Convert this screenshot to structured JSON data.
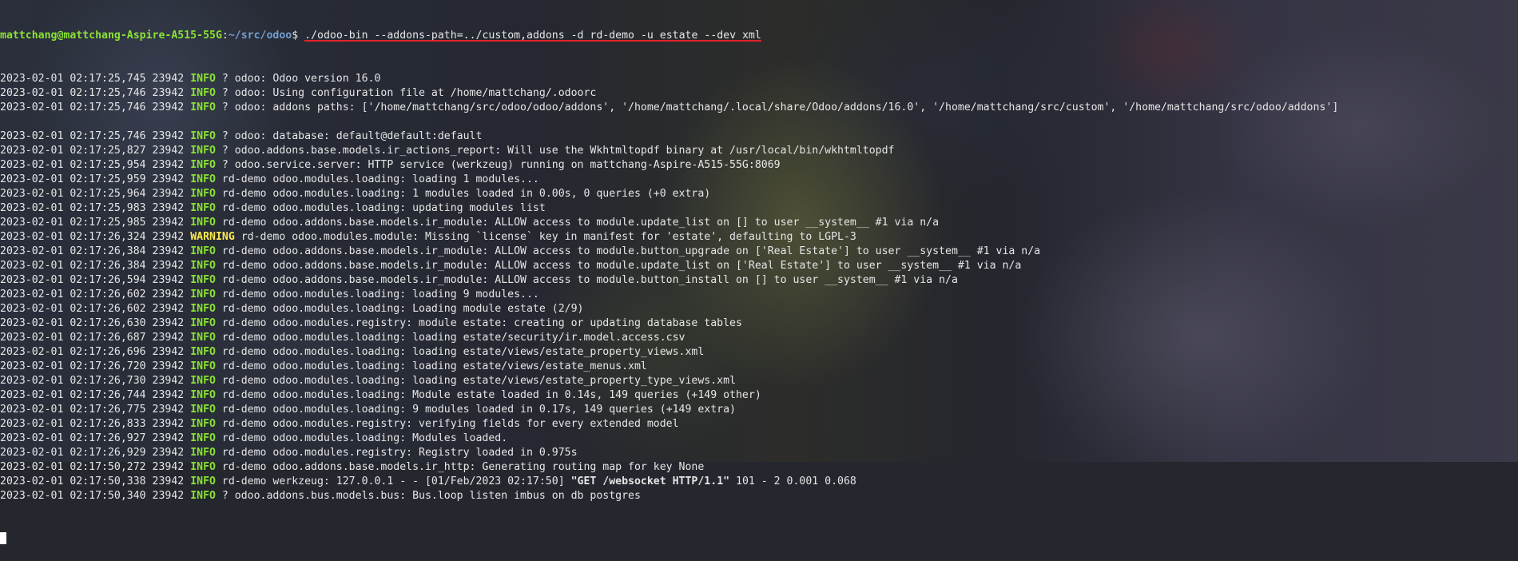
{
  "prompt": {
    "user_host": "mattchang@mattchang-Aspire-A515-55G",
    "separator": ":",
    "path": "~/src/odoo",
    "symbol": "$ ",
    "command": "./odoo-bin --addons-path=../custom,addons -d rd-demo -u estate --dev xml"
  },
  "log_lines": [
    {
      "ts": "2023-02-01 02:17:25,745 23942 ",
      "level": "INFO",
      "msg": " ? odoo: Odoo version 16.0"
    },
    {
      "ts": "2023-02-01 02:17:25,746 23942 ",
      "level": "INFO",
      "msg": " ? odoo: Using configuration file at /home/mattchang/.odoorc"
    },
    {
      "ts": "2023-02-01 02:17:25,746 23942 ",
      "level": "INFO",
      "msg": " ? odoo: addons paths: ['/home/mattchang/src/odoo/odoo/addons', '/home/mattchang/.local/share/Odoo/addons/16.0', '/home/mattchang/src/custom', '/home/mattchang/src/odoo/addons']"
    },
    {
      "ts": "",
      "level": "",
      "msg": ""
    },
    {
      "ts": "2023-02-01 02:17:25,746 23942 ",
      "level": "INFO",
      "msg": " ? odoo: database: default@default:default"
    },
    {
      "ts": "2023-02-01 02:17:25,827 23942 ",
      "level": "INFO",
      "msg": " ? odoo.addons.base.models.ir_actions_report: Will use the Wkhtmltopdf binary at /usr/local/bin/wkhtmltopdf"
    },
    {
      "ts": "2023-02-01 02:17:25,954 23942 ",
      "level": "INFO",
      "msg": " ? odoo.service.server: HTTP service (werkzeug) running on mattchang-Aspire-A515-55G:8069"
    },
    {
      "ts": "2023-02-01 02:17:25,959 23942 ",
      "level": "INFO",
      "msg": " rd-demo odoo.modules.loading: loading 1 modules..."
    },
    {
      "ts": "2023-02-01 02:17:25,964 23942 ",
      "level": "INFO",
      "msg": " rd-demo odoo.modules.loading: 1 modules loaded in 0.00s, 0 queries (+0 extra)"
    },
    {
      "ts": "2023-02-01 02:17:25,983 23942 ",
      "level": "INFO",
      "msg": " rd-demo odoo.modules.loading: updating modules list"
    },
    {
      "ts": "2023-02-01 02:17:25,985 23942 ",
      "level": "INFO",
      "msg": " rd-demo odoo.addons.base.models.ir_module: ALLOW access to module.update_list on [] to user __system__ #1 via n/a"
    },
    {
      "ts": "2023-02-01 02:17:26,324 23942 ",
      "level": "WARNING",
      "msg": " rd-demo odoo.modules.module: Missing `license` key in manifest for 'estate', defaulting to LGPL-3"
    },
    {
      "ts": "2023-02-01 02:17:26,384 23942 ",
      "level": "INFO",
      "msg": " rd-demo odoo.addons.base.models.ir_module: ALLOW access to module.button_upgrade on ['Real Estate'] to user __system__ #1 via n/a"
    },
    {
      "ts": "2023-02-01 02:17:26,384 23942 ",
      "level": "INFO",
      "msg": " rd-demo odoo.addons.base.models.ir_module: ALLOW access to module.update_list on ['Real Estate'] to user __system__ #1 via n/a"
    },
    {
      "ts": "2023-02-01 02:17:26,594 23942 ",
      "level": "INFO",
      "msg": " rd-demo odoo.addons.base.models.ir_module: ALLOW access to module.button_install on [] to user __system__ #1 via n/a"
    },
    {
      "ts": "2023-02-01 02:17:26,602 23942 ",
      "level": "INFO",
      "msg": " rd-demo odoo.modules.loading: loading 9 modules..."
    },
    {
      "ts": "2023-02-01 02:17:26,602 23942 ",
      "level": "INFO",
      "msg": " rd-demo odoo.modules.loading: Loading module estate (2/9)"
    },
    {
      "ts": "2023-02-01 02:17:26,630 23942 ",
      "level": "INFO",
      "msg": " rd-demo odoo.modules.registry: module estate: creating or updating database tables"
    },
    {
      "ts": "2023-02-01 02:17:26,687 23942 ",
      "level": "INFO",
      "msg": " rd-demo odoo.modules.loading: loading estate/security/ir.model.access.csv"
    },
    {
      "ts": "2023-02-01 02:17:26,696 23942 ",
      "level": "INFO",
      "msg": " rd-demo odoo.modules.loading: loading estate/views/estate_property_views.xml"
    },
    {
      "ts": "2023-02-01 02:17:26,720 23942 ",
      "level": "INFO",
      "msg": " rd-demo odoo.modules.loading: loading estate/views/estate_menus.xml"
    },
    {
      "ts": "2023-02-01 02:17:26,730 23942 ",
      "level": "INFO",
      "msg": " rd-demo odoo.modules.loading: loading estate/views/estate_property_type_views.xml"
    },
    {
      "ts": "2023-02-01 02:17:26,744 23942 ",
      "level": "INFO",
      "msg": " rd-demo odoo.modules.loading: Module estate loaded in 0.14s, 149 queries (+149 other)"
    },
    {
      "ts": "2023-02-01 02:17:26,775 23942 ",
      "level": "INFO",
      "msg": " rd-demo odoo.modules.loading: 9 modules loaded in 0.17s, 149 queries (+149 extra)"
    },
    {
      "ts": "2023-02-01 02:17:26,833 23942 ",
      "level": "INFO",
      "msg": " rd-demo odoo.modules.registry: verifying fields for every extended model"
    },
    {
      "ts": "2023-02-01 02:17:26,927 23942 ",
      "level": "INFO",
      "msg": " rd-demo odoo.modules.loading: Modules loaded."
    },
    {
      "ts": "2023-02-01 02:17:26,929 23942 ",
      "level": "INFO",
      "msg": " rd-demo odoo.modules.registry: Registry loaded in 0.975s"
    },
    {
      "ts": "2023-02-01 02:17:50,272 23942 ",
      "level": "INFO",
      "msg": " rd-demo odoo.addons.base.models.ir_http: Generating routing map for key None"
    },
    {
      "ts": "2023-02-01 02:17:50,338 23942 ",
      "level": "INFO",
      "msg": " rd-demo werkzeug: 127.0.0.1 - - [01/Feb/2023 02:17:50] ",
      "bold": "\"GET /websocket HTTP/1.1\"",
      "tail": " 101 - 2 0.001 0.068"
    },
    {
      "ts": "2023-02-01 02:17:50,340 23942 ",
      "level": "INFO",
      "msg": " ? odoo.addons.bus.models.bus: Bus.loop listen imbus on db postgres"
    }
  ],
  "colors": {
    "info": "#8ae234",
    "warning": "#fce94f",
    "prompt_user": "#8ae234",
    "prompt_path": "#729fcf",
    "underline": "#e0242b"
  }
}
